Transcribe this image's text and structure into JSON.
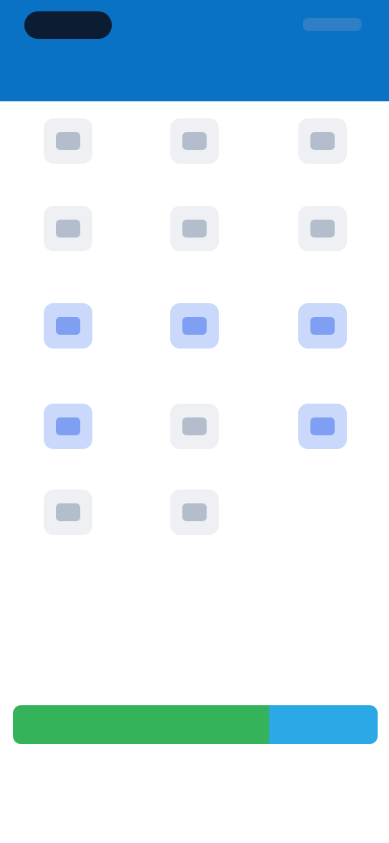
{
  "header": {
    "title": "",
    "colors": {
      "background": "#0a72c4",
      "status_pill": "#0b1c33"
    }
  },
  "grid": {
    "tiles": [
      {
        "label": "",
        "icon": "app-icon",
        "tone": "gray"
      },
      {
        "label": "",
        "icon": "app-icon",
        "tone": "gray"
      },
      {
        "label": "",
        "icon": "app-icon",
        "tone": "gray"
      },
      {
        "label": "",
        "icon": "app-icon",
        "tone": "gray"
      },
      {
        "label": "",
        "icon": "app-icon",
        "tone": "gray"
      },
      {
        "label": "",
        "icon": "app-icon",
        "tone": "gray"
      },
      {
        "label": "",
        "icon": "app-icon",
        "tone": "blue"
      },
      {
        "label": "",
        "icon": "app-icon",
        "tone": "blue"
      },
      {
        "label": "",
        "icon": "app-icon",
        "tone": "blue"
      },
      {
        "label": "",
        "icon": "app-icon",
        "tone": "blue"
      },
      {
        "label": "",
        "icon": "app-icon",
        "tone": "gray"
      },
      {
        "label": "",
        "icon": "app-icon",
        "tone": "blue"
      },
      {
        "label": "",
        "icon": "app-icon",
        "tone": "gray"
      },
      {
        "label": "",
        "icon": "app-icon",
        "tone": "gray"
      }
    ]
  },
  "footer": {
    "left_label": "",
    "right_label": "",
    "primary_button": "",
    "secondary_button": "",
    "link": "",
    "colors": {
      "primary": "#34b35a",
      "secondary": "#2aa9e6",
      "accent": "#f06b6b"
    }
  }
}
